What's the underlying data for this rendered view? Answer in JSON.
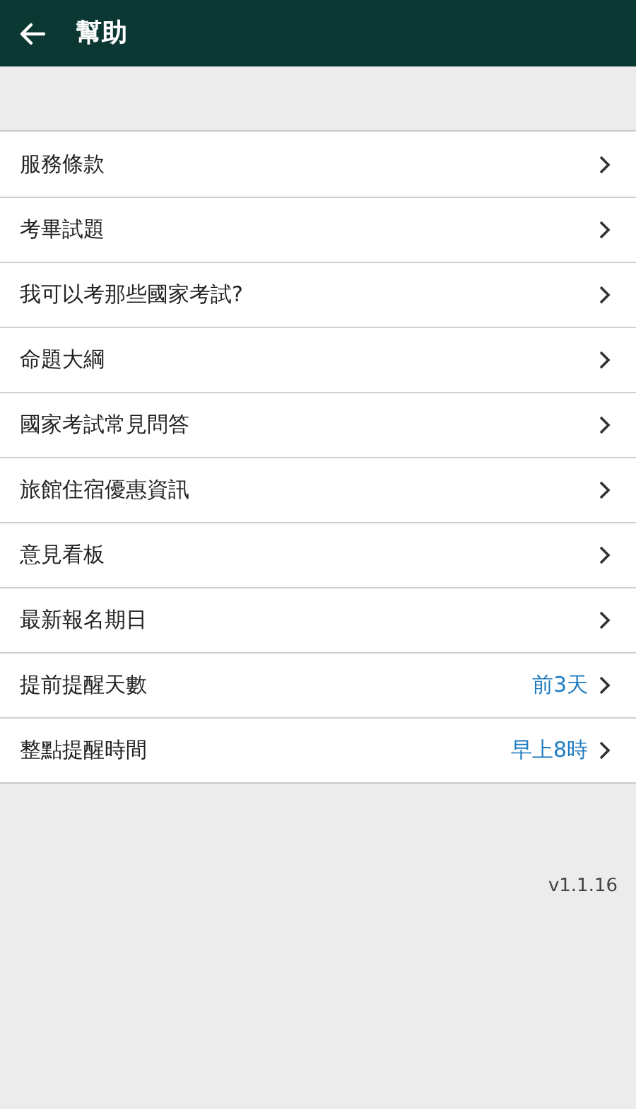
{
  "header": {
    "title": "幫助"
  },
  "items": [
    {
      "label": "服務條款"
    },
    {
      "label": "考畢試題"
    },
    {
      "label": "我可以考那些國家考試?"
    },
    {
      "label": "命題大綱"
    },
    {
      "label": "國家考試常見問答"
    },
    {
      "label": "旅館住宿優惠資訊"
    },
    {
      "label": "意見看板"
    },
    {
      "label": "最新報名期日"
    },
    {
      "label": "提前提醒天數",
      "value": "前3天"
    },
    {
      "label": "整點提醒時間",
      "value": "早上8時"
    }
  ],
  "version": "v1.1.16"
}
